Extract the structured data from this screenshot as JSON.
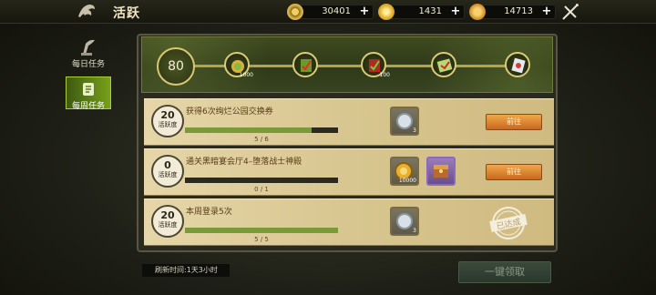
{
  "header": {
    "title": "活跃"
  },
  "resources": [
    {
      "icon": "gear-coin-icon",
      "value": "30401",
      "color": "#d8b44a"
    },
    {
      "icon": "gold-ingot-icon",
      "value": "1431",
      "color": "#f0c040"
    },
    {
      "icon": "gold-coin-icon",
      "value": "14713",
      "color": "#e8a828"
    }
  ],
  "nav": {
    "daily": "每日任务",
    "weekly": "每周任务"
  },
  "activity": {
    "points": "80",
    "milestones": [
      {
        "icon": "coin-pouch-icon",
        "count": "1000"
      },
      {
        "icon": "green-scroll-icon",
        "count": ""
      },
      {
        "icon": "red-scroll-icon",
        "count": "100"
      },
      {
        "icon": "map-scroll-icon",
        "count": ""
      },
      {
        "icon": "crystal-card-icon",
        "count": ""
      }
    ]
  },
  "tasks": [
    {
      "points": "20",
      "points_label": "活跃度",
      "name": "获得6次绚烂公园交换券",
      "progress": "5 / 6",
      "progress_value": 0.83,
      "rewards": [
        {
          "icon": "silver-orb-icon",
          "count": "3"
        }
      ],
      "action": "前往",
      "completed": false
    },
    {
      "points": "0",
      "points_label": "活跃度",
      "name": "通关黑暗宴会厅4–堕落战士神殿",
      "progress": "0 / 1",
      "progress_value": 0,
      "rewards": [
        {
          "icon": "gold-coin-icon",
          "count": "10000"
        },
        {
          "icon": "treasure-chest-icon",
          "count": ""
        }
      ],
      "action": "前往",
      "completed": false
    },
    {
      "points": "20",
      "points_label": "活跃度",
      "name": "本周登录5次",
      "progress": "5 / 5",
      "progress_value": 1,
      "rewards": [
        {
          "icon": "silver-orb-icon",
          "count": "3"
        }
      ],
      "action": "",
      "completed": true,
      "stamp": "已达成"
    }
  ],
  "footer": {
    "refresh": "刷新时间:1天3小时",
    "claim_all": "一键领取"
  }
}
